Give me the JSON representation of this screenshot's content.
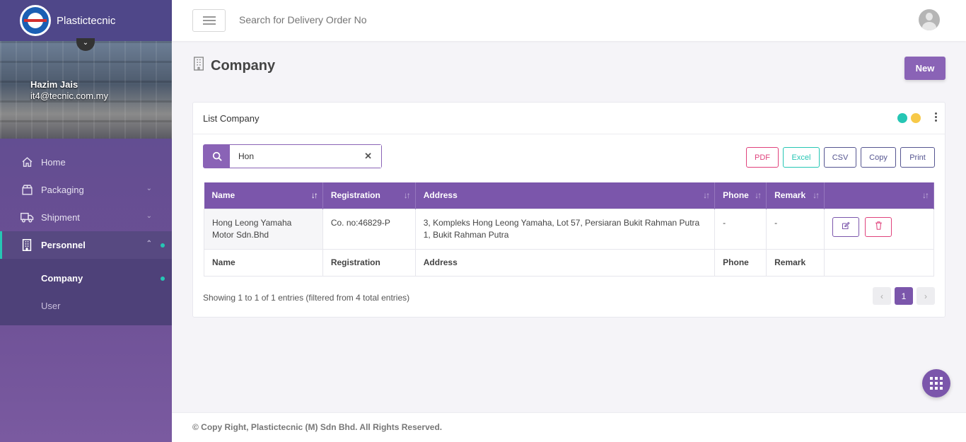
{
  "brand": {
    "name": "Plastictecnic"
  },
  "profile": {
    "name": "Hazim Jais",
    "email": "it4@tecnic.com.my"
  },
  "sidebar": {
    "items": [
      {
        "label": "Home",
        "icon": "home-icon"
      },
      {
        "label": "Packaging",
        "icon": "package-icon"
      },
      {
        "label": "Shipment",
        "icon": "truck-icon"
      },
      {
        "label": "Personnel",
        "icon": "building-icon"
      }
    ],
    "sub_items": [
      {
        "label": "Company"
      },
      {
        "label": "User"
      }
    ]
  },
  "topbar": {
    "search_placeholder": "Search for Delivery Order No"
  },
  "page": {
    "title": "Company",
    "new_label": "New"
  },
  "card": {
    "title": "List Company",
    "search_value": "Hon",
    "export": {
      "pdf": "PDF",
      "excel": "Excel",
      "csv": "CSV",
      "copy": "Copy",
      "print": "Print"
    },
    "columns": [
      "Name",
      "Registration",
      "Address",
      "Phone",
      "Remark"
    ],
    "rows": [
      {
        "name": "Hong Leong Yamaha Motor Sdn.Bhd",
        "registration": "Co. no:46829-P",
        "address": "3, Kompleks Hong Leong Yamaha, Lot 57, Persiaran Bukit Rahman Putra 1, Bukit Rahman Putra",
        "phone": "-",
        "remark": "-"
      }
    ],
    "info": "Showing 1 to 1 of 1 entries (filtered from 4 total entries)",
    "current_page": "1"
  },
  "footer": {
    "text": "© Copy Right, Plastictecnic (M) Sdn Bhd. All Rights Reserved."
  },
  "colors": {
    "accent": "#7b56ab",
    "teal": "#26c6b4",
    "yellow": "#f7c948",
    "pink": "#e0427c"
  }
}
